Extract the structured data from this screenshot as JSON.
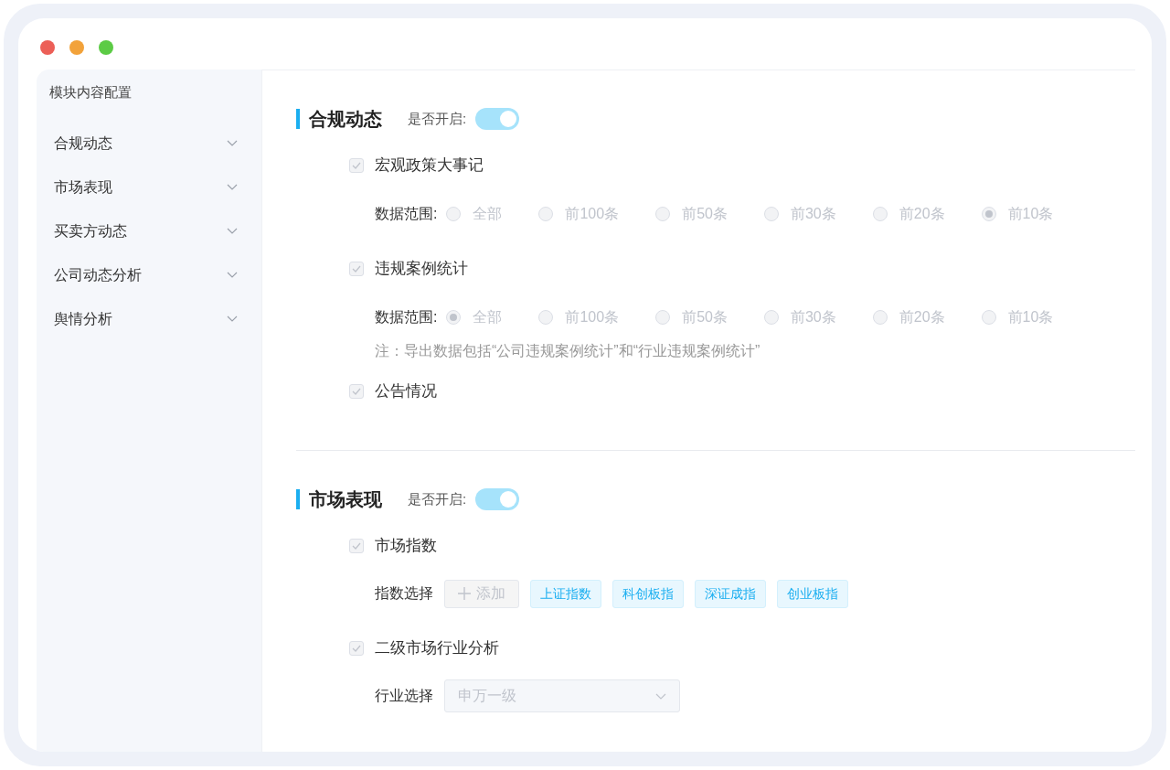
{
  "sidebar": {
    "title": "模块内容配置",
    "items": [
      {
        "label": "合规动态",
        "expanded": false
      },
      {
        "label": "市场表现",
        "expanded": false
      },
      {
        "label": "买卖方动态",
        "expanded": false
      },
      {
        "label": "公司动态分析",
        "expanded": false
      },
      {
        "label": "舆情分析",
        "expanded": false
      }
    ]
  },
  "sections": [
    {
      "title": "合规动态",
      "toggle_label": "是否开启:",
      "on": true,
      "items": [
        {
          "label": "宏观政策大事记",
          "checked": true,
          "rows": [
            {
              "kind": "radio",
              "label": "数据范围:",
              "choices": [
                {
                  "label": "全部",
                  "selected": false
                },
                {
                  "label": "前100条",
                  "selected": false
                },
                {
                  "label": "前50条",
                  "selected": false
                },
                {
                  "label": "前30条",
                  "selected": false
                },
                {
                  "label": "前20条",
                  "selected": false
                },
                {
                  "label": "前10条",
                  "selected": true
                }
              ]
            }
          ]
        },
        {
          "label": "违规案例统计",
          "checked": true,
          "rows": [
            {
              "kind": "radio",
              "label": "数据范围:",
              "choices": [
                {
                  "label": "全部",
                  "selected": true
                },
                {
                  "label": "前100条",
                  "selected": false
                },
                {
                  "label": "前50条",
                  "selected": false
                },
                {
                  "label": "前30条",
                  "selected": false
                },
                {
                  "label": "前20条",
                  "selected": false
                },
                {
                  "label": "前10条",
                  "selected": false
                }
              ]
            },
            {
              "kind": "note",
              "text": "注：导出数据包括“公司违规案例统计”和“行业违规案例统计”"
            }
          ]
        },
        {
          "label": "公告情况",
          "checked": true
        }
      ]
    },
    {
      "title": "市场表现",
      "toggle_label": "是否开启:",
      "on": true,
      "items": [
        {
          "label": "市场指数",
          "checked": true,
          "rows": [
            {
              "kind": "tags",
              "label": "指数选择",
              "add_button": "添加",
              "tags": [
                "上证指数",
                "科创板指",
                "深证成指",
                "创业板指"
              ]
            }
          ]
        },
        {
          "label": "二级市场行业分析",
          "checked": true,
          "rows": [
            {
              "kind": "select",
              "label": "行业选择",
              "value": "申万一级"
            }
          ]
        }
      ]
    }
  ]
}
